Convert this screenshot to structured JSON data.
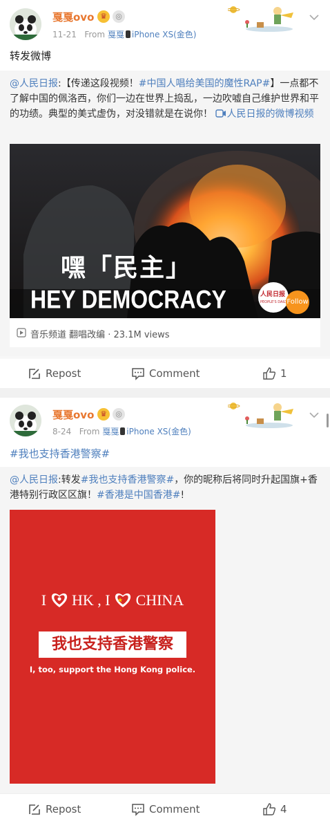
{
  "posts": [
    {
      "user": {
        "name": "戛戛ovo",
        "crown_icon": "crown-badge-icon",
        "level_icon": "level-badge-icon"
      },
      "date": "11-21",
      "source_from": "From",
      "source_user": "戛戛",
      "source_device": "iPhone XS(金色)",
      "text": "转发微博",
      "repost": {
        "author": "@人民日报",
        "sep": ":",
        "text1": "【传递这段视频！",
        "tag": "#中国人唱给美国的魔性RAP#",
        "text2": "】一点都不了解中国的佩洛西，你们一边在世界上捣乱，一边吹嘘自己维护世界和平的功绩。典型的美式虚伪，对没错就是在说你！",
        "video_link": "人民日报的微博视频",
        "video": {
          "caption_cn": "嘿「民主」",
          "caption_en": "HEY DEMOCRACY",
          "logo_text": "人民日报",
          "logo_sub": "PEOPLE'S DAILY",
          "follow": "Follow",
          "meta": "音乐频道 翻唱改编 · 23.1M views"
        }
      },
      "actions": {
        "repost": "Repost",
        "comment": "Comment",
        "likes": "1"
      }
    },
    {
      "user": {
        "name": "戛戛ovo",
        "crown_icon": "crown-badge-icon",
        "level_icon": "level-badge-icon"
      },
      "date": "8-24",
      "source_from": "From",
      "source_user": "戛戛",
      "source_device": "iPhone XS(金色)",
      "text": "#我也支持香港警察#",
      "repost": {
        "author": "@人民日报",
        "sep": ":转发",
        "tag": "#我也支持香港警察#",
        "text1": "，你的昵称后将同时升起国旗+香港特别行政区区旗！",
        "tag2": "#香港是中国香港#",
        "text2": "!",
        "image": {
          "line1_a": "I",
          "line1_b": "HK , I",
          "line1_c": "CHINA",
          "banner": "我也支持香港警察",
          "subtitle": "I, too, support the Hong Kong police."
        }
      },
      "actions": {
        "repost": "Repost",
        "comment": "Comment",
        "likes": "4"
      }
    }
  ],
  "colors": {
    "accent": "#e8772f",
    "link": "#4e7fbd",
    "poster_red": "#d72a26"
  }
}
